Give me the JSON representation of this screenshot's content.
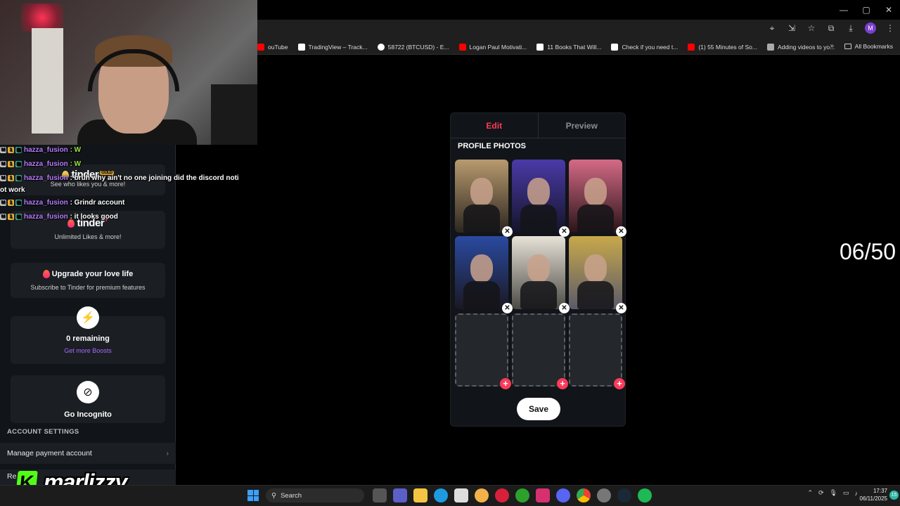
{
  "bookmarks": {
    "items": [
      {
        "label": "ouTube",
        "color": "#ff0000"
      },
      {
        "label": "TradingView – Track...",
        "color": "#ffffff"
      },
      {
        "label": "58722 (BTCUSD) - E...",
        "color": "#ffffff"
      },
      {
        "label": "Logan Paul Motivati...",
        "color": "#ff0000"
      },
      {
        "label": "11 Books That Will...",
        "color": "#ffffff"
      },
      {
        "label": "Check if you need t...",
        "color": "#ffffff"
      },
      {
        "label": "(1) 55 Minutes of So...",
        "color": "#ff0000"
      },
      {
        "label": "Adding videos to yo...",
        "color": "#aaaaaa"
      }
    ],
    "all_label": "All Bookmarks",
    "more_icon": "»"
  },
  "window_controls": {
    "minimize": "—",
    "maximize": "▢",
    "close": "✕"
  },
  "profile_avatar": "M",
  "chat": [
    {
      "user": "hazza_fusion",
      "text": ": W"
    },
    {
      "user": "hazza_fusion",
      "text": ": W"
    },
    {
      "user": "hazza_fusion",
      "text": ": bruh why ain't no one joining did the discord noti"
    },
    {
      "user": "",
      "text": "ot work"
    },
    {
      "user": "hazza_fusion",
      "text": ": Grindr account"
    },
    {
      "user": "hazza_fusion",
      "text": ": it looks good"
    }
  ],
  "left_panel": {
    "gold_logo": "tinder",
    "gold_badge": "GOLD",
    "gold_sub": "See who likes you & more!",
    "plus_logo": "tinder",
    "plus_badge": "+",
    "plus_sub": "Unlimited Likes & more!",
    "upgrade_title": "Upgrade your love life",
    "upgrade_sub": "Subscribe to Tinder for premium features",
    "boosts_remaining": "0 remaining",
    "boosts_link": "Get more Boosts",
    "incognito_label": "Go Incognito",
    "account_settings_title": "ACCOUNT SETTINGS",
    "manage_payment": "Manage payment account",
    "restore": "Re"
  },
  "watermark": {
    "k": "K",
    "name": "marlizzy"
  },
  "editor": {
    "tab_edit": "Edit",
    "tab_preview": "Preview",
    "section_title": "PROFILE PHOTOS",
    "photos": [
      {
        "filled": true,
        "color_top": "#b89a6e",
        "color_bottom": "#2c2620"
      },
      {
        "filled": true,
        "color_top": "#4a3aa8",
        "color_bottom": "#141428"
      },
      {
        "filled": true,
        "color_top": "#d46a86",
        "color_bottom": "#2a1418"
      },
      {
        "filled": true,
        "color_top": "#2a4aa0",
        "color_bottom": "#1a1822"
      },
      {
        "filled": true,
        "color_top": "#e8e2d8",
        "color_bottom": "#4a4a44"
      },
      {
        "filled": true,
        "color_top": "#c8a84a",
        "color_bottom": "#5a5a6a"
      },
      {
        "filled": false
      },
      {
        "filled": false
      },
      {
        "filled": false
      }
    ],
    "remove_icon": "✕",
    "add_icon": "+",
    "save_label": "Save"
  },
  "counter": "06/50",
  "taskbar": {
    "search_label": "Search",
    "time": "17:37",
    "date": "06/11/2025",
    "notification_count": "15"
  },
  "colors": {
    "accent": "#fd3a5a",
    "boost": "#a66bff",
    "kick_green": "#53fc18"
  }
}
